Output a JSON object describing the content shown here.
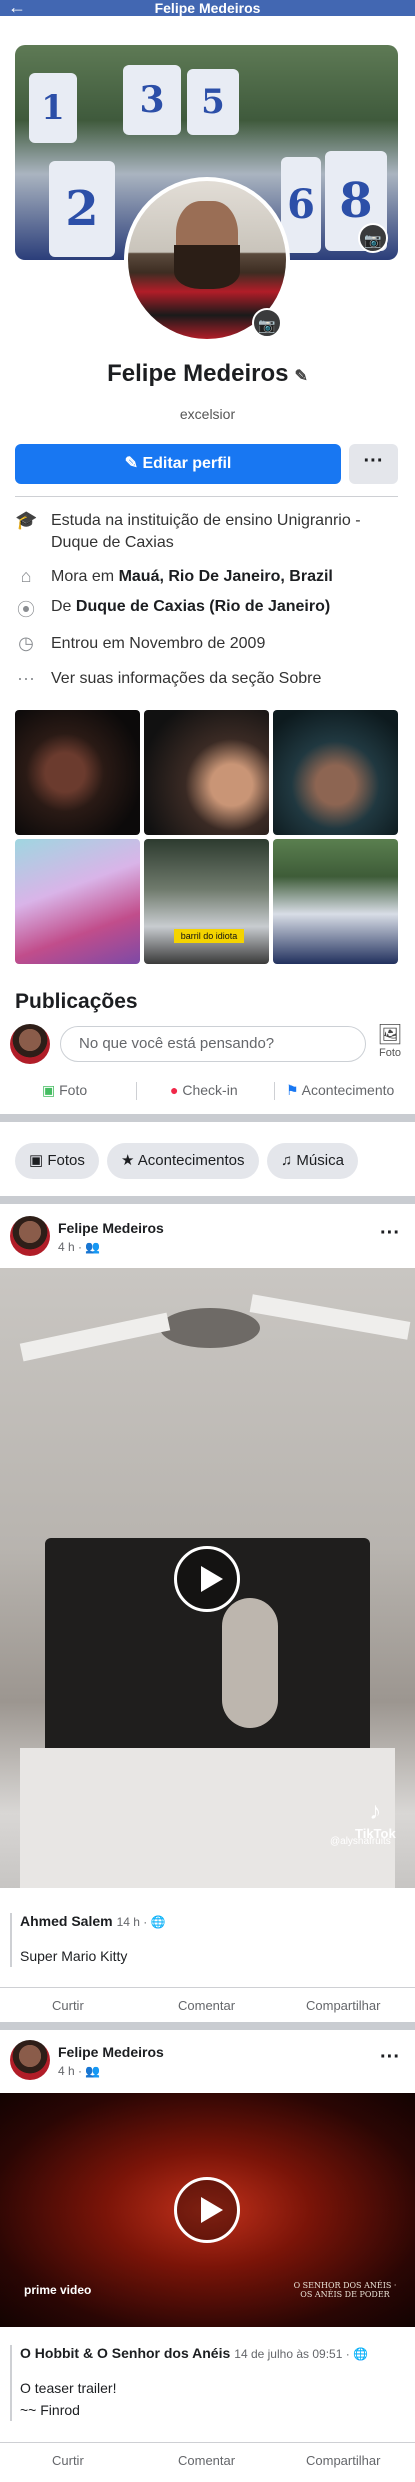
{
  "header": {
    "title": "Felipe Medeiros",
    "back_icon": "back-arrow-icon"
  },
  "profile": {
    "name": "Felipe Medeiros",
    "bio": "excelsior",
    "edit_button": "Editar perfil",
    "more_button": "···",
    "accent_color": "#1877f2",
    "cover_jersey_numbers": [
      "1",
      "3",
      "5",
      "2",
      "6",
      "8"
    ]
  },
  "intro": [
    {
      "icon": "graduation-cap-icon",
      "prefix": "Estuda na instituição de ensino Unigranrio - Duque de Caxias",
      "bold": ""
    },
    {
      "icon": "house-icon",
      "prefix": "Mora em ",
      "bold": "Mauá, Rio De Janeiro, Brazil"
    },
    {
      "icon": "location-pin-icon",
      "prefix": "De ",
      "bold": "Duque de Caxias (Rio de Janeiro)"
    },
    {
      "icon": "clock-icon",
      "prefix": "Entrou em Novembro de 2009",
      "bold": ""
    },
    {
      "icon": "ellipsis-icon",
      "prefix": "Ver suas informações da seção Sobre",
      "bold": ""
    }
  ],
  "photo_grid": {
    "caption_overlay": "barril do idiota"
  },
  "publications": {
    "title": "Publicações",
    "composer_placeholder": "No que você está pensando?",
    "composer_photo_label": "Foto",
    "actions": [
      "Foto",
      "Check-in",
      "Acontecimento"
    ],
    "chips": [
      "Fotos",
      "Acontecimentos",
      "Música"
    ]
  },
  "posts": [
    {
      "author": "Felipe Medeiros",
      "time": "4 h · ",
      "more": "···",
      "watermark": "TikTok",
      "watermark_handle": "@alyshafruits",
      "shared_author": "Ahmed Salem",
      "shared_time": "14 h · ",
      "shared_text": "Super Mario Kitty",
      "shared_text2": "",
      "actions": [
        "Curtir",
        "Comentar",
        "Compartilhar"
      ]
    },
    {
      "author": "Felipe Medeiros",
      "time": "4 h · ",
      "more": "···",
      "watermark": "prime video",
      "watermark_handle": "O SENHOR DOS ANÉIS · OS ANÉIS DE PODER",
      "shared_author": "O Hobbit & O Senhor dos Anéis",
      "shared_time": "14 de julho às 09:51 · ",
      "shared_text": "O teaser trailer!",
      "shared_text2": "~~ Finrod",
      "actions": [
        "Curtir",
        "Comentar",
        "Compartilhar"
      ]
    }
  ]
}
